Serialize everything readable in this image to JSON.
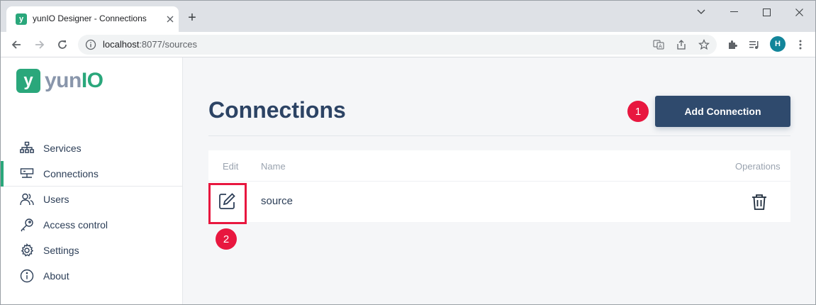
{
  "browser": {
    "tab_title": "yunIO Designer - Connections",
    "tab_favicon_letter": "y",
    "new_tab_symbol": "+",
    "url_host": "localhost",
    "url_rest": ":8077/sources",
    "profile_initial": "H"
  },
  "app": {
    "logo_letter": "y",
    "logo_text_prefix": "yun",
    "logo_text_suffix": "IO"
  },
  "sidebar": {
    "items": [
      {
        "label": "Services",
        "icon": "services-hierarchy-icon",
        "active": false
      },
      {
        "label": "Connections",
        "icon": "connections-icon",
        "active": true
      },
      {
        "label": "Users",
        "icon": "users-icon",
        "active": false
      },
      {
        "label": "Access control",
        "icon": "key-icon",
        "active": false
      },
      {
        "label": "Settings",
        "icon": "gear-icon",
        "active": false
      },
      {
        "label": "About",
        "icon": "info-icon",
        "active": false
      }
    ]
  },
  "main": {
    "title": "Connections",
    "add_button_label": "Add Connection",
    "table": {
      "headers": {
        "edit": "Edit",
        "name": "Name",
        "operations": "Operations"
      },
      "rows": [
        {
          "name": "source"
        }
      ]
    }
  },
  "annotations": {
    "marker_1": "1",
    "marker_2": "2"
  },
  "colors": {
    "brand_green": "#2aa77b",
    "primary_button": "#2f4a6d",
    "title_text": "#2c4364",
    "annotation_red": "#e8173f"
  }
}
